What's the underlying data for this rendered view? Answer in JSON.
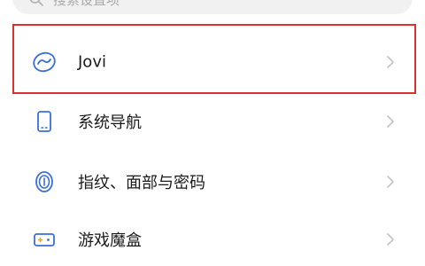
{
  "search": {
    "placeholder": "搜索设置项",
    "icon": "search-icon"
  },
  "settings": {
    "items": [
      {
        "label": "Jovi",
        "icon": "jovi-icon"
      },
      {
        "label": "系统导航",
        "icon": "phone-navigation-icon"
      },
      {
        "label": "指纹、面部与密码",
        "icon": "fingerprint-icon"
      },
      {
        "label": "游戏魔盒",
        "icon": "game-box-icon"
      }
    ]
  },
  "colors": {
    "highlight": "#d9312b",
    "icon_blue": "#3a6fd8",
    "chevron": "#c4c4c4"
  }
}
